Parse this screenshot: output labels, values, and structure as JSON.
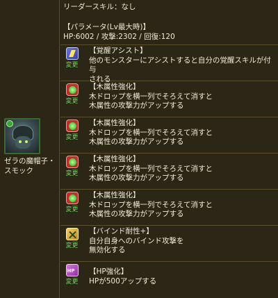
{
  "header": {
    "leader_skill": "リーダースキル：なし",
    "params_title": "【パラメータ(Lv最大時)】",
    "params": "HP:6002 / 攻撃:2302 / 回復:120"
  },
  "monster": {
    "name_line1": "ゼラの魔帽子・",
    "name_line2": "スモック",
    "icon": "monster-portrait",
    "attribute_color": "#3da23a"
  },
  "change_label": "変更",
  "awakenings": [
    {
      "icon": "assist-awakening-icon",
      "title": "【覚醒アシスト】",
      "desc1": "他のモンスターにアシストすると自分の覚醒スキルが付与",
      "desc2": "される"
    },
    {
      "icon": "wood-enhance-icon",
      "title": "【木属性強化】",
      "desc1": "木ドロップを横一列でそろえて消すと",
      "desc2": "木属性の攻撃力がアップする"
    },
    {
      "icon": "wood-enhance-icon",
      "title": "【木属性強化】",
      "desc1": "木ドロップを横一列でそろえて消すと",
      "desc2": "木属性の攻撃力がアップする"
    },
    {
      "icon": "wood-enhance-icon",
      "title": "【木属性強化】",
      "desc1": "木ドロップを横一列でそろえて消すと",
      "desc2": "木属性の攻撃力がアップする"
    },
    {
      "icon": "wood-enhance-icon",
      "title": "【木属性強化】",
      "desc1": "木ドロップを横一列でそろえて消すと",
      "desc2": "木属性の攻撃力がアップする"
    },
    {
      "icon": "bind-resist-plus-icon",
      "title": "【バインド耐性+】",
      "desc1": "自分自身へのバインド攻撃を",
      "desc2": "無効化する"
    },
    {
      "icon": "hp-enhance-icon",
      "title": "【HP強化】",
      "desc1": "HPが500アップする",
      "desc2": ""
    }
  ],
  "colors": {
    "background": "#2b2616",
    "border": "#5a5030",
    "text": "#f2ecd6",
    "change_link": "#6fd25b"
  }
}
